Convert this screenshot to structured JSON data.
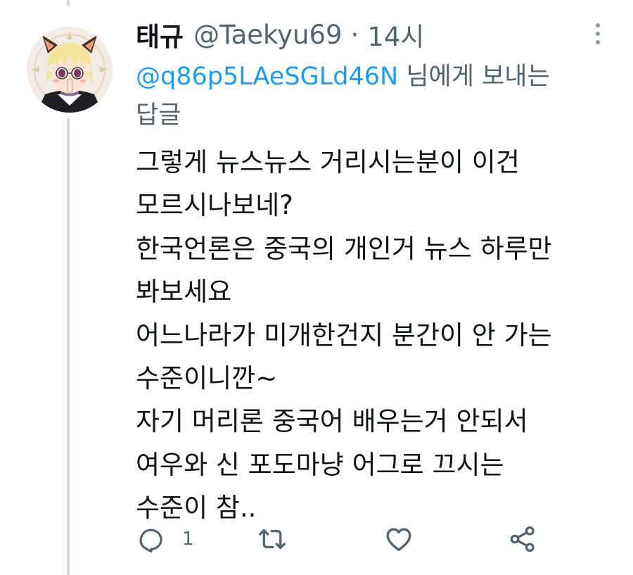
{
  "tweet": {
    "author_name": "태규",
    "author_handle": "@Taekyu69",
    "separator": "·",
    "time": "14시",
    "reply_to_handle": "@q86p5LAeSGLd46N",
    "reply_to_suffix": " 님에게 보내는 답글",
    "body": "그렇게 뉴스뉴스 거리시는분이 이건\n모르시나보네?\n한국언론은 중국의 개인거 뉴스 하루만\n봐보세요\n어느나라가 미개한건지 분간이 안 가는\n수준이니깐~\n자기 머리론 중국어 배우는거 안되서\n여우와 신 포도마냥 어그로 끄시는\n수준이 참..",
    "reply_count": "1"
  },
  "icons": {
    "more": "more-vertical-icon",
    "reply": "reply-bubble-icon",
    "retweet": "retweet-icon",
    "like": "heart-icon",
    "share": "share-icon"
  },
  "colors": {
    "text": "#0f1419",
    "secondary": "#536471",
    "link": "#1d9bf0",
    "thread_line": "#cfd9de"
  }
}
